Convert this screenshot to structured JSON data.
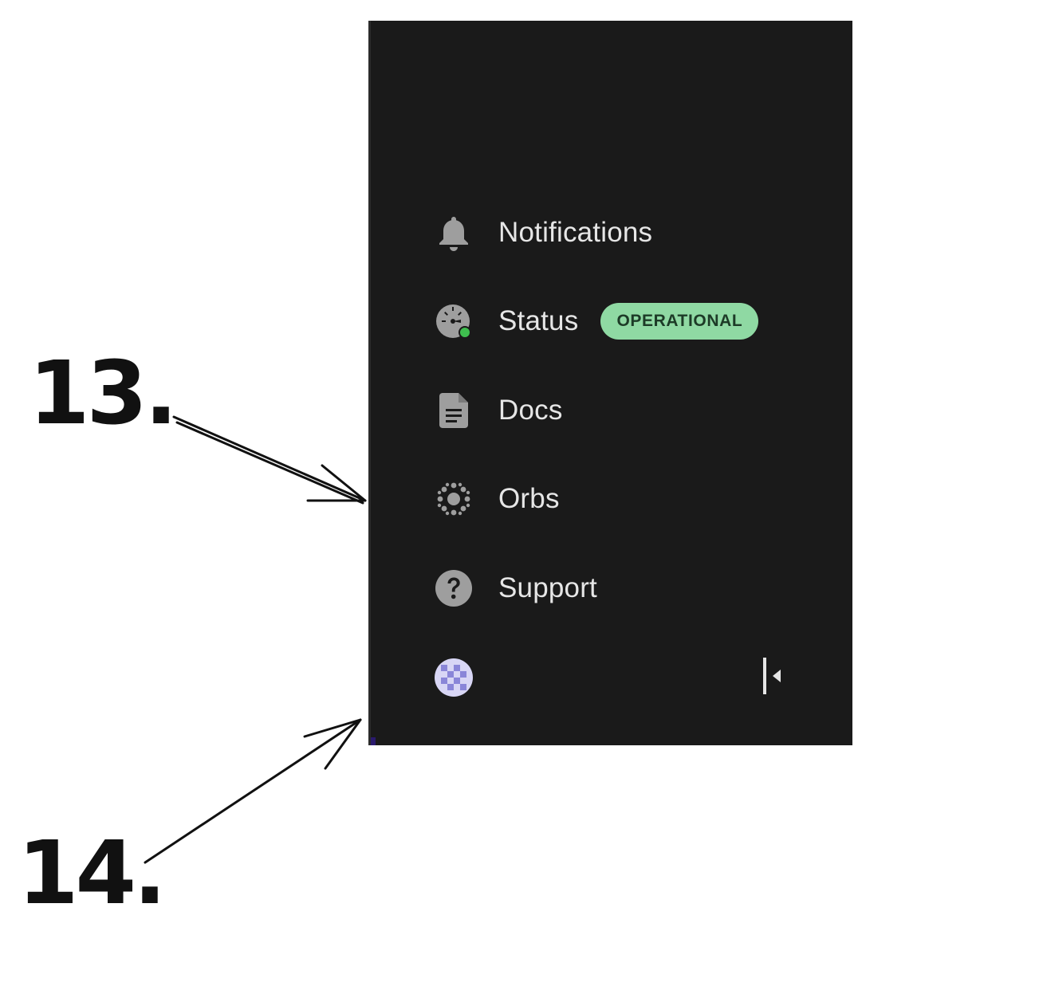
{
  "sidebar": {
    "items": [
      {
        "id": "notifications",
        "label": "Notifications",
        "icon": "bell-icon"
      },
      {
        "id": "status",
        "label": "Status",
        "icon": "speedometer-icon",
        "badge": "OPERATIONAL"
      },
      {
        "id": "docs",
        "label": "Docs",
        "icon": "document-icon"
      },
      {
        "id": "orbs",
        "label": "Orbs",
        "icon": "orbs-icon"
      },
      {
        "id": "support",
        "label": "Support",
        "icon": "help-circle-icon"
      }
    ],
    "footer": {
      "avatar_icon": "user-avatar",
      "collapse_icon": "collapse-sidebar-icon"
    }
  },
  "annotations": [
    {
      "label": "13."
    },
    {
      "label": "14."
    }
  ],
  "colors": {
    "panel_bg": "#1a1a1a",
    "text": "#e6e6e6",
    "icon": "#9e9e9e",
    "badge_bg": "#8fd9a3",
    "badge_text": "#1d3b27",
    "status_dot": "#3fbf4f",
    "avatar_light": "#d8d6f5",
    "avatar_dark": "#8a86d8"
  }
}
